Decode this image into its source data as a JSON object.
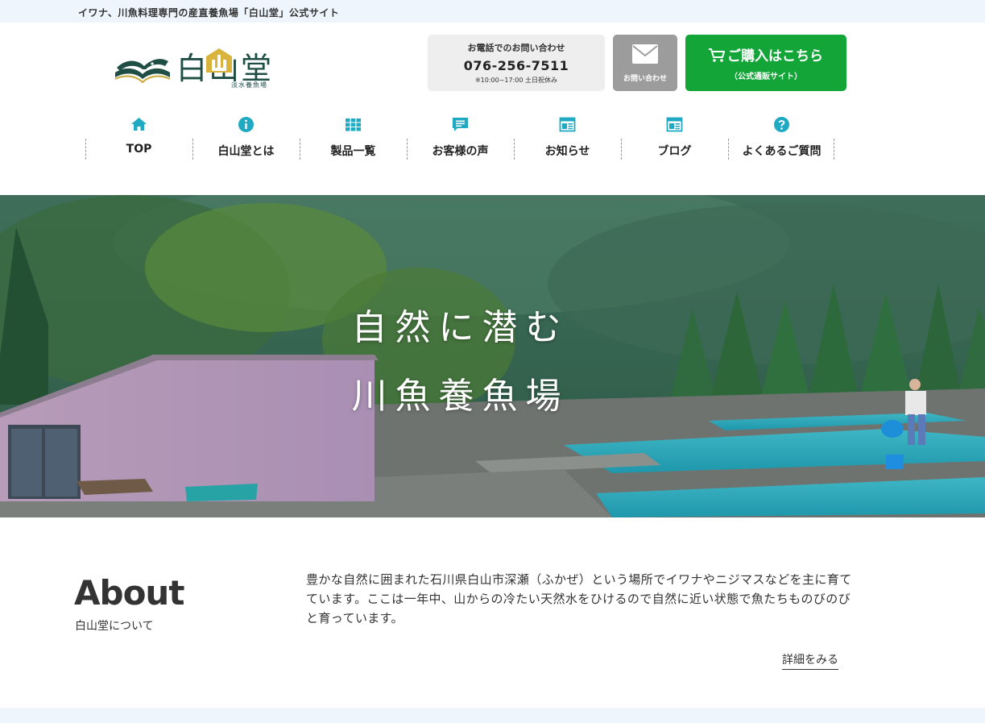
{
  "topbar": {
    "tagline": "イワナ、川魚料理専門の産直養魚場「白山堂」公式サイト"
  },
  "logo": {
    "name": "白山堂",
    "sub": "淡水養魚場",
    "icon": "fish-book-logo-icon"
  },
  "contact": {
    "phone_title": "お電話でのお問い合わせ",
    "phone_number": "076-256-7511",
    "phone_hours": "※10:00~17:00 土日祝休み",
    "mail_label": "お問い合わせ",
    "mail_icon": "envelope-icon"
  },
  "buy": {
    "label": "ご購入はこちら",
    "sub": "（公式通販サイト）",
    "icon": "cart-icon",
    "color": "#13a538"
  },
  "nav": {
    "accent": "#1fa9c2",
    "items": [
      {
        "label": "TOP",
        "icon": "home-icon"
      },
      {
        "label": "白山堂とは",
        "icon": "info-icon"
      },
      {
        "label": "製品一覧",
        "icon": "grid-icon"
      },
      {
        "label": "お客様の声",
        "icon": "comment-icon"
      },
      {
        "label": "お知らせ",
        "icon": "news-icon"
      },
      {
        "label": "ブログ",
        "icon": "blog-icon"
      },
      {
        "label": "よくあるご質問",
        "icon": "question-icon"
      }
    ]
  },
  "hero": {
    "line1": "自然に潜む",
    "line2": "川魚養魚場"
  },
  "about": {
    "title": "About",
    "subtitle": "白山堂について",
    "text": "豊かな自然に囲まれた石川県白山市深瀬（ふかぜ）という場所でイワナやニジマスなどを主に育てています。ここは一年中、山からの冷たい天然水をひけるので自然に近い状態で魚たちものびのびと育っています。",
    "more": "詳細をみる"
  }
}
